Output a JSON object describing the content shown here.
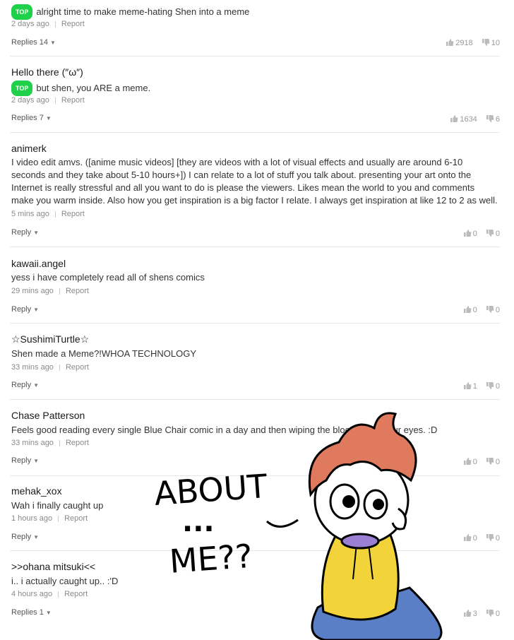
{
  "comments": [
    {
      "author": "",
      "badge": "TOP",
      "text": "alright time to make meme-hating Shen into a meme",
      "time": "2 days ago",
      "report": "Report",
      "replies": "Replies 14",
      "likes": "2918",
      "dislikes": "10"
    },
    {
      "author": "Hello there (″ω″)",
      "badge": "TOP",
      "text": "but shen, you ARE a meme.",
      "time": "2 days ago",
      "report": "Report",
      "replies": "Replies 7",
      "likes": "1634",
      "dislikes": "6"
    },
    {
      "author": "animerk",
      "badge": "",
      "text": "I video edit amvs. ([anime music videos] [they are videos with a lot of visual effects and usually are around 6-10 seconds and they take about 5-10 hours+]) I can relate to a lot of stuff you talk about. presenting your art onto the Internet is really stressful and all you want to do is please the viewers. Likes mean the world to you and comments make you warm inside. Also how you get inspiration is a big factor I relate. I always get inspiration at like 12 to 2 as well.",
      "time": "5 mins ago",
      "report": "Report",
      "replies": "Reply",
      "likes": "0",
      "dislikes": "0"
    },
    {
      "author": "kawaii.angel",
      "badge": "",
      "text": "yess i have completely read all of shens comics",
      "time": "29 mins ago",
      "report": "Report",
      "replies": "Reply",
      "likes": "0",
      "dislikes": "0"
    },
    {
      "author": "☆SushimiTurtle☆",
      "badge": "",
      "text": "Shen made a Meme?!WHOA TECHNOLOGY",
      "time": "33 mins ago",
      "report": "Report",
      "replies": "Reply",
      "likes": "1",
      "dislikes": "0"
    },
    {
      "author": "Chase Patterson",
      "badge": "",
      "text": "Feels good reading every single Blue Chair comic in a day and then wiping the blood out of your eyes. :D",
      "time": "33 mins ago",
      "report": "Report",
      "replies": "Reply",
      "likes": "0",
      "dislikes": "0"
    },
    {
      "author": "mehak_xox",
      "badge": "",
      "text": "Wah i finally caught up",
      "time": "1 hours ago",
      "report": "Report",
      "replies": "Reply",
      "likes": "0",
      "dislikes": "0"
    },
    {
      "author": ">>ohana mitsuki<<",
      "badge": "",
      "text": "i.. i actually caught up.. :'D",
      "time": "4 hours ago",
      "report": "Report",
      "replies": "Replies 1",
      "likes": "3",
      "dislikes": "0"
    }
  ],
  "doodle": {
    "line1": "ABOUT",
    "line2": "...",
    "line3": "ME??"
  },
  "colors": {
    "top_badge": "#1fd04a",
    "hair": "#e07a5f",
    "hoodie": "#f2d43a",
    "pants": "#5a7fc7",
    "mouth": "#9b7fd4"
  }
}
